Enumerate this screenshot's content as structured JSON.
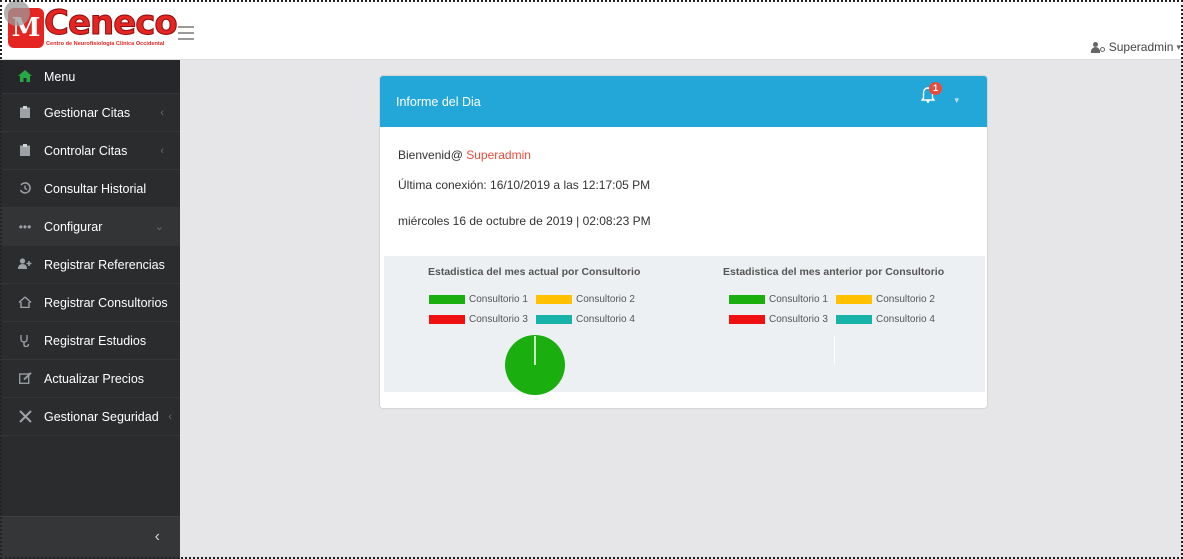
{
  "brand": {
    "logo_text": "Ceneco",
    "tagline": "Centro de Neurofisiología Clínica Occidental"
  },
  "user": {
    "name": "Superadmin",
    "caret": "▾"
  },
  "sidebar": {
    "items": [
      {
        "label": "Menu",
        "icon": "home-icon"
      },
      {
        "label": "Gestionar Citas",
        "icon": "clipboard-icon",
        "chevron": "‹"
      },
      {
        "label": "Controlar Citas",
        "icon": "clipboard-icon",
        "chevron": "‹"
      },
      {
        "label": "Consultar Historial",
        "icon": "history-icon"
      },
      {
        "label": "Configurar",
        "icon": "ellipsis-icon",
        "chevron": "⌄"
      },
      {
        "label": "Registrar Referencias",
        "icon": "user-plus-icon"
      },
      {
        "label": "Registrar Consultorios",
        "icon": "home-icon"
      },
      {
        "label": "Registrar Estudios",
        "icon": "stethoscope-icon"
      },
      {
        "label": "Actualizar Precios",
        "icon": "edit-icon"
      },
      {
        "label": "Gestionar Seguridad",
        "icon": "tools-icon",
        "chevron": "‹"
      }
    ],
    "collapse_glyph": "‹"
  },
  "report": {
    "title": "Informe del Dia",
    "notifications": "1",
    "greeting_prefix": "Bienvenid@ ",
    "greeting_user": "Superadmin",
    "last_login": "Última conexión: 16/10/2019 a las 12:17:05 PM",
    "datetime": "miércoles 16 de octubre de 2019 | 02:08:23 PM"
  },
  "colors": {
    "accent": "#22a7d8",
    "consultorio_1": "#1aaf0f",
    "consultorio_2": "#ffc000",
    "consultorio_3": "#ee1111",
    "consultorio_4": "#17b3a8"
  },
  "chart_data": [
    {
      "type": "pie",
      "title": "Estadistica del mes actual por Consultorio",
      "legend": [
        "Consultorio 1",
        "Consultorio 2",
        "Consultorio 3",
        "Consultorio 4"
      ],
      "values": [
        1,
        0,
        0,
        0
      ]
    },
    {
      "type": "pie",
      "title": "Estadistica del mes anterior por Consultorio",
      "legend": [
        "Consultorio 1",
        "Consultorio 2",
        "Consultorio 3",
        "Consultorio 4"
      ],
      "values": [
        0,
        0,
        0,
        0
      ]
    }
  ]
}
